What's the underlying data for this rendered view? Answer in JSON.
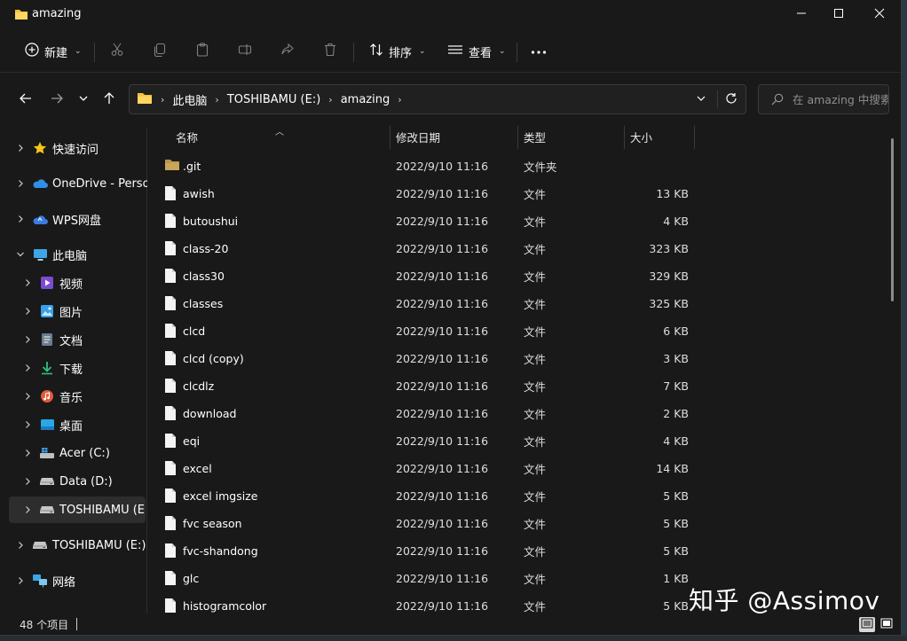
{
  "window": {
    "title": "amazing",
    "controls": {
      "minimize": "minimize-icon",
      "maximize": "maximize-icon",
      "close": "close-icon"
    }
  },
  "toolbar": {
    "new_label": "新建",
    "sort_label": "排序",
    "view_label": "查看"
  },
  "address": {
    "crumbs": [
      "此电脑",
      "TOSHIBAMU (E:)",
      "amazing"
    ]
  },
  "search": {
    "placeholder": "在 amazing 中搜索"
  },
  "sidebar": {
    "items": [
      {
        "label": "快速访问",
        "icon": "star-icon",
        "level": 0
      },
      {
        "label": "OneDrive - Personal",
        "icon": "onedrive-cloud-icon",
        "level": 0
      },
      {
        "label": "WPS网盘",
        "icon": "wps-cloud-icon",
        "level": 0
      },
      {
        "label": "此电脑",
        "icon": "computer-icon",
        "level": 0,
        "expanded": true
      },
      {
        "label": "视频",
        "icon": "video-icon",
        "level": 1
      },
      {
        "label": "图片",
        "icon": "pictures-icon",
        "level": 1
      },
      {
        "label": "文档",
        "icon": "documents-icon",
        "level": 1
      },
      {
        "label": "下载",
        "icon": "download-icon",
        "level": 1
      },
      {
        "label": "音乐",
        "icon": "music-icon",
        "level": 1
      },
      {
        "label": "桌面",
        "icon": "desktop-icon",
        "level": 1
      },
      {
        "label": "Acer (C:)",
        "icon": "windows-drive-icon",
        "level": 1
      },
      {
        "label": "Data (D:)",
        "icon": "drive-icon",
        "level": 1
      },
      {
        "label": "TOSHIBAMU (E:)",
        "icon": "drive-icon",
        "level": 1,
        "selected": true
      },
      {
        "label": "TOSHIBAMU (E:)",
        "icon": "drive-icon",
        "level": 0
      },
      {
        "label": "网络",
        "icon": "network-icon",
        "level": 0
      }
    ]
  },
  "columns": {
    "name": "名称",
    "date": "修改日期",
    "type": "类型",
    "size": "大小"
  },
  "files": [
    {
      "name": ".git",
      "date": "2022/9/10 11:16",
      "type": "文件夹",
      "size": "",
      "icon": "folder-icon"
    },
    {
      "name": "awish",
      "date": "2022/9/10 11:16",
      "type": "文件",
      "size": "13 KB",
      "icon": "file-icon"
    },
    {
      "name": "butoushui",
      "date": "2022/9/10 11:16",
      "type": "文件",
      "size": "4 KB",
      "icon": "file-icon"
    },
    {
      "name": "class-20",
      "date": "2022/9/10 11:16",
      "type": "文件",
      "size": "323 KB",
      "icon": "file-icon"
    },
    {
      "name": "class30",
      "date": "2022/9/10 11:16",
      "type": "文件",
      "size": "329 KB",
      "icon": "file-icon"
    },
    {
      "name": "classes",
      "date": "2022/9/10 11:16",
      "type": "文件",
      "size": "325 KB",
      "icon": "file-icon"
    },
    {
      "name": "clcd",
      "date": "2022/9/10 11:16",
      "type": "文件",
      "size": "6 KB",
      "icon": "file-icon"
    },
    {
      "name": "clcd (copy)",
      "date": "2022/9/10 11:16",
      "type": "文件",
      "size": "3 KB",
      "icon": "file-icon"
    },
    {
      "name": "clcdlz",
      "date": "2022/9/10 11:16",
      "type": "文件",
      "size": "7 KB",
      "icon": "file-icon"
    },
    {
      "name": "download",
      "date": "2022/9/10 11:16",
      "type": "文件",
      "size": "2 KB",
      "icon": "file-icon"
    },
    {
      "name": "eqi",
      "date": "2022/9/10 11:16",
      "type": "文件",
      "size": "4 KB",
      "icon": "file-icon"
    },
    {
      "name": "excel",
      "date": "2022/9/10 11:16",
      "type": "文件",
      "size": "14 KB",
      "icon": "file-icon"
    },
    {
      "name": "excel imgsize",
      "date": "2022/9/10 11:16",
      "type": "文件",
      "size": "5 KB",
      "icon": "file-icon"
    },
    {
      "name": "fvc season",
      "date": "2022/9/10 11:16",
      "type": "文件",
      "size": "5 KB",
      "icon": "file-icon"
    },
    {
      "name": "fvc-shandong",
      "date": "2022/9/10 11:16",
      "type": "文件",
      "size": "5 KB",
      "icon": "file-icon"
    },
    {
      "name": "glc",
      "date": "2022/9/10 11:16",
      "type": "文件",
      "size": "1 KB",
      "icon": "file-icon"
    },
    {
      "name": "histogramcolor",
      "date": "2022/9/10 11:16",
      "type": "文件",
      "size": "5 KB",
      "icon": "file-icon"
    }
  ],
  "status": {
    "count_text": "48 个项目"
  },
  "watermark": {
    "text": "知乎 @Assimov"
  },
  "colors": {
    "accent_folder": "#f4c142",
    "background": "#191919",
    "selected": "#2d2d2d"
  }
}
